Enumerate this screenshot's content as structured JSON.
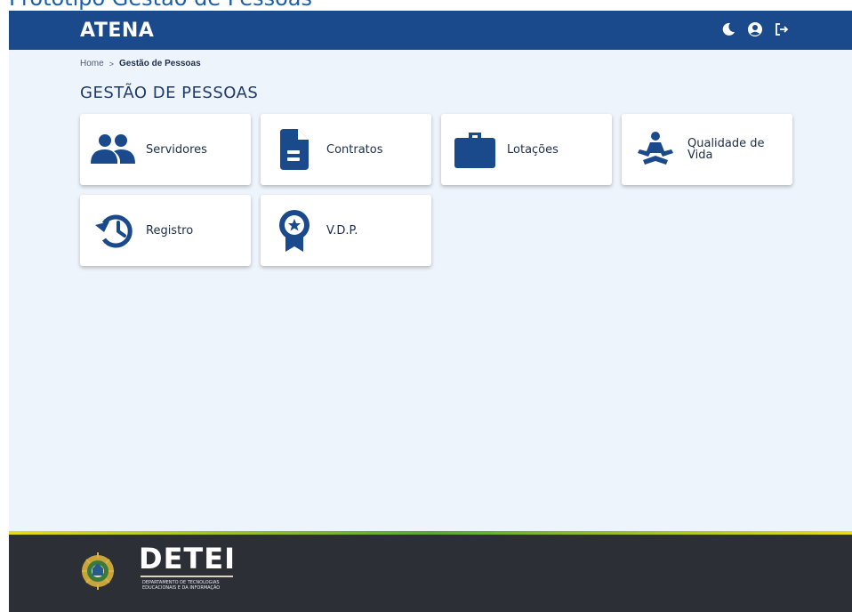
{
  "document_title": "Protótipo Gestão de Pessoas",
  "app": {
    "brand": "ATENA"
  },
  "header_icons": [
    "moon-icon",
    "user-circle-icon",
    "logout-icon"
  ],
  "breadcrumb": {
    "home": "Home",
    "separator": ">",
    "current": "Gestão de Pessoas"
  },
  "page": {
    "title": "GESTÃO DE PESSOAS"
  },
  "cards": [
    {
      "label": "Servidores",
      "icon": "users-icon"
    },
    {
      "label": "Contratos",
      "icon": "document-icon"
    },
    {
      "label": "Lotações",
      "icon": "briefcase-icon"
    },
    {
      "label": "Qualidade de Vida",
      "icon": "meditation-icon"
    },
    {
      "label": "Registro",
      "icon": "history-icon"
    },
    {
      "label": "V.D.P.",
      "icon": "award-icon"
    }
  ],
  "footer": {
    "logo_text": "DETEI",
    "logo_sub_1": "DEPARTAMENTO DE TECNOLOGIAS",
    "logo_sub_2": "EDUCACIONAIS E DA INFORMAÇÃO"
  },
  "colors": {
    "primary": "#1a4a8c",
    "background": "#eef4fb",
    "footer": "#2c2f36",
    "accent_stripe": "#e5dd18"
  }
}
